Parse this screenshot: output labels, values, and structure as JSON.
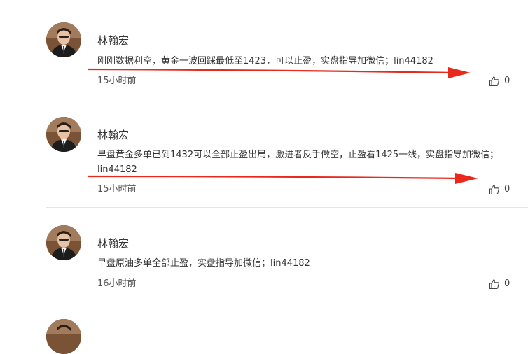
{
  "comments": [
    {
      "username": "林翰宏",
      "content": "刚刚数据利空，黄金一波回踩最低至1423，可以止盈，实盘指导加微信；lin44182",
      "time": "15小时前",
      "likes": "0"
    },
    {
      "username": "林翰宏",
      "content": "早盘黄金多单已到1432可以全部止盈出局，激进者反手做空，止盈看1425一线，实盘指导加微信；lin44182",
      "time": "15小时前",
      "likes": "0"
    },
    {
      "username": "林翰宏",
      "content": "早盘原油多单全部止盈，实盘指导加微信；lin44182",
      "time": "16小时前",
      "likes": "0"
    }
  ],
  "annotation_color": "#e8291c"
}
